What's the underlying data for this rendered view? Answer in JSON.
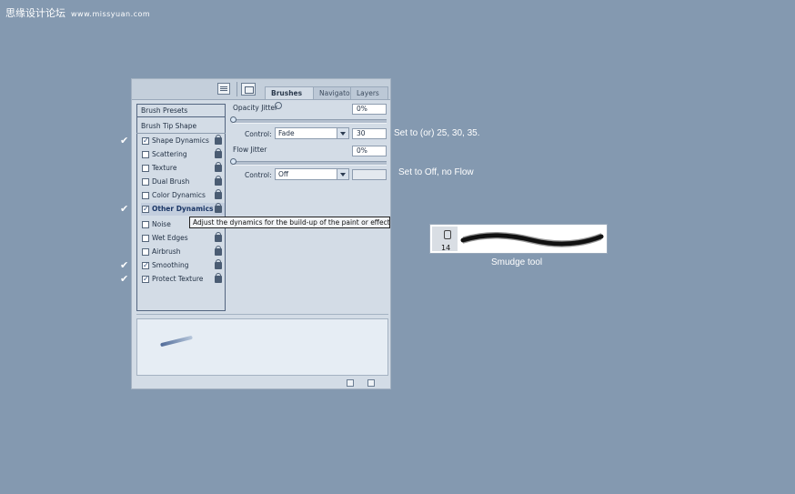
{
  "watermark": {
    "main": "思缘设计论坛",
    "sub": "www.missyuan.com"
  },
  "palette": {
    "tabs": [
      "Brushes",
      "Navigator",
      "Layers"
    ],
    "brush_presets": "Brush Presets",
    "brush_tip_shape": "Brush Tip Shape",
    "options": [
      {
        "label": "Shape Dynamics",
        "checked": true,
        "lock": true
      },
      {
        "label": "Scattering",
        "checked": false,
        "lock": true
      },
      {
        "label": "Texture",
        "checked": false,
        "lock": true
      },
      {
        "label": "Dual Brush",
        "checked": false,
        "lock": true
      },
      {
        "label": "Color Dynamics",
        "checked": false,
        "lock": true
      },
      {
        "label": "Other Dynamics",
        "checked": true,
        "lock": true,
        "selected": true
      },
      {
        "label": "Noise",
        "checked": false,
        "lock": false
      },
      {
        "label": "Wet Edges",
        "checked": false,
        "lock": true
      },
      {
        "label": "Airbrush",
        "checked": false,
        "lock": true
      },
      {
        "label": "Smoothing",
        "checked": true,
        "lock": true
      },
      {
        "label": "Protect Texture",
        "checked": true,
        "lock": true
      }
    ],
    "opacity_jitter": {
      "label": "Opacity Jitter",
      "value": "0%",
      "slider_fraction": 0
    },
    "opacity_control": {
      "label": "Control:",
      "value": "Fade",
      "steps": "30"
    },
    "flow_jitter": {
      "label": "Flow Jitter",
      "value": "0%",
      "slider_fraction": 0
    },
    "flow_control": {
      "label": "Control:",
      "value": "Off",
      "steps": ""
    },
    "tooltip": "Adjust the dynamics for the build-up of the paint or effect"
  },
  "annotations": {
    "opacity_note": "Set to (or) 25, 30, 35.",
    "flow_note": "Set to Off, no Flow",
    "check_mark": "✔"
  },
  "smudge": {
    "brush_size": "14",
    "label": "Smudge tool"
  }
}
